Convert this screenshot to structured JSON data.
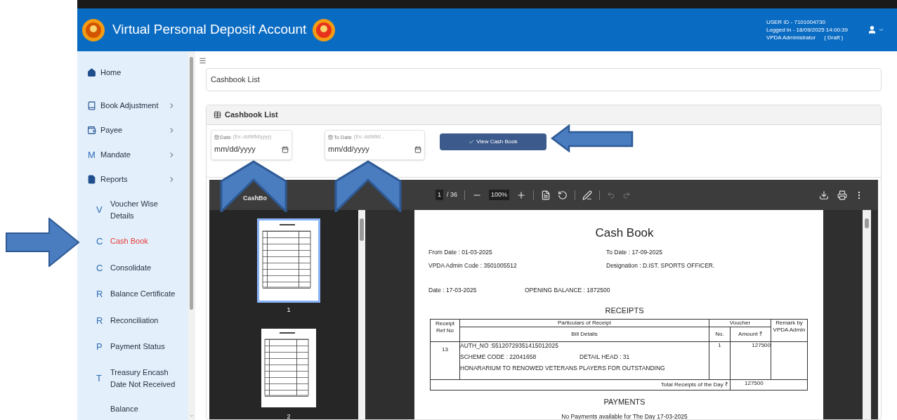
{
  "header": {
    "title": "Virtual Personal Deposit Account",
    "user_lines": [
      "USER ID - 7101004730",
      "Logged In - 18/09/2025 14:00:39"
    ],
    "role": "VPDA Administrator",
    "status": "( Draft )"
  },
  "sidebar": {
    "items": [
      {
        "kind": "home",
        "label": "Home",
        "selected": false,
        "submenu": false
      },
      {
        "kind": "book",
        "label": "Book Adjustment",
        "selected": false,
        "submenu": true
      },
      {
        "kind": "wallet",
        "label": "Payee",
        "selected": false,
        "submenu": true
      },
      {
        "kind": "letter",
        "letter": "M",
        "label": "Mandate",
        "selected": false,
        "submenu": true
      },
      {
        "kind": "file",
        "label": "Reports",
        "selected": false,
        "submenu": true
      }
    ],
    "subitems": [
      {
        "letter": "V",
        "label": "Voucher Wise Details",
        "selected": false
      },
      {
        "letter": "C",
        "label": "Cash Book",
        "selected": true
      },
      {
        "letter": "C",
        "label": "Consolidate",
        "selected": false
      },
      {
        "letter": "R",
        "label": "Balance Certificate",
        "selected": false
      },
      {
        "letter": "R",
        "label": "Reconciliation",
        "selected": false
      },
      {
        "letter": "P",
        "label": "Payment Status",
        "selected": false
      },
      {
        "letter": "T",
        "label": "Treasury Encash Date Not Received",
        "selected": false
      },
      {
        "label": "Balance",
        "selected": false
      }
    ]
  },
  "breadcrumb": "Cashbook List",
  "card": {
    "title": "Cashbook List",
    "fields": [
      {
        "label": "Date",
        "hint": "(Ex:-dd/MM/yyyy)",
        "placeholder": "mm/dd/yyyy"
      },
      {
        "label": "To Date",
        "hint": "(Ex:-dd/MM/...",
        "placeholder": "mm/dd/yyyy"
      }
    ],
    "button": "View Cash Book"
  },
  "viewer": {
    "title": "CashBo",
    "page": "1",
    "page_total": "/ 36",
    "zoom": "100%",
    "thumbnails": [
      {
        "label": "1",
        "selected": true
      },
      {
        "label": "2",
        "selected": false
      }
    ],
    "document": {
      "title": "Cash Book",
      "from": "From Date  : 01-03-2025",
      "to": "To Date   : 17-09-2025",
      "admin_code": "VPDA Admin Code  : 3501005512",
      "designation": "Designation : D.IST. SPORTS OFFICER.",
      "date": "Date : 17-03-2025",
      "opening_balance": "OPENING BALANCE : 1872500",
      "receipts_title": "RECEIPTS",
      "headers": {
        "ref": "Receipt Ref No",
        "particulars": "Particulars of Receipt",
        "bill": "Bill Details",
        "voucher": "Voucher",
        "no": "No.",
        "amount": "Amount ₹",
        "remark": "Remark by VPDA Admin"
      },
      "row": {
        "ref": "13",
        "auth": "AUTH_NO :55120729351415012025",
        "scheme": "SCHEME CODE : 22041658",
        "detail_head": "DETAIL HEAD : 31",
        "purpose": "HONARARIUM TO RENOWED VETERANS PLAYERS FOR OUTSTANDING",
        "no": "1",
        "amount": "127500"
      },
      "total_label": "Total Receipts of the Day ₹",
      "total": "127500",
      "payments_title": "PAYMENTS",
      "payments_note": "No Payments available for The Day 17-03-2025"
    }
  }
}
